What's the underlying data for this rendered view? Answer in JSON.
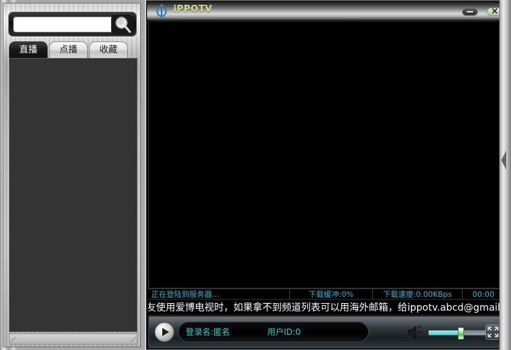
{
  "sidebar": {
    "search": {
      "value": "",
      "placeholder": "",
      "icon": "search-icon"
    },
    "tabs": [
      {
        "label": "直播",
        "active": true
      },
      {
        "label": "点播",
        "active": false
      },
      {
        "label": "收藏",
        "active": false
      }
    ],
    "list": {
      "items": [],
      "empty_text": ""
    }
  },
  "player": {
    "titlebar": {
      "logo": "ippotv-logo-icon",
      "title": "iPPOTV",
      "minimize_label": "",
      "close_label": "×"
    },
    "video": {
      "background_color": "#000000"
    },
    "statusbar": {
      "server": "正在登陆到服务器...",
      "buffer": "下载缓冲:0%",
      "speed": "下载速度:0.00KBps",
      "time": "00:00"
    },
    "marquee": {
      "text": "友使用爱博电视时，如果拿不到频道列表可以用海外邮箱，给ippotv.abcd@gmail.com发一封电子"
    },
    "controls": {
      "play_icon": "play-icon",
      "login_name": "登录名:匿名",
      "user_id": "用户ID:0",
      "speaker_icon": "speaker-icon",
      "volume_percent": 48,
      "fullscreen_icon": "fullscreen-icon"
    }
  },
  "collapse_handle": {
    "icon": "chevron-left-icon"
  },
  "colors": {
    "accent_cyan": "#2fd4d4",
    "status_cyan": "#27b7d4",
    "title_gold": "#d8d98a",
    "video_black": "#000000"
  }
}
